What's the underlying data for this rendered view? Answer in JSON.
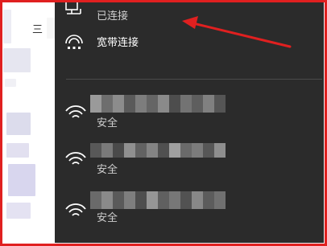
{
  "background": {
    "glyph": "三"
  },
  "network": {
    "items": [
      {
        "name": "",
        "status": "已连接",
        "icon": "ethernet-icon"
      },
      {
        "name": "宽带连接",
        "status": "",
        "icon": "dialup-icon"
      },
      {
        "name": "",
        "status": "安全",
        "icon": "wifi-icon",
        "name_hidden": true
      },
      {
        "name": "",
        "status": "安全",
        "icon": "wifi-icon",
        "name_hidden": true
      },
      {
        "name": "",
        "status": "安全",
        "icon": "wifi-icon",
        "name_hidden": true
      }
    ]
  },
  "colors": {
    "flyout_bg": "#2b2b2b",
    "annotation": "#e02020",
    "text": "#ffffff"
  }
}
